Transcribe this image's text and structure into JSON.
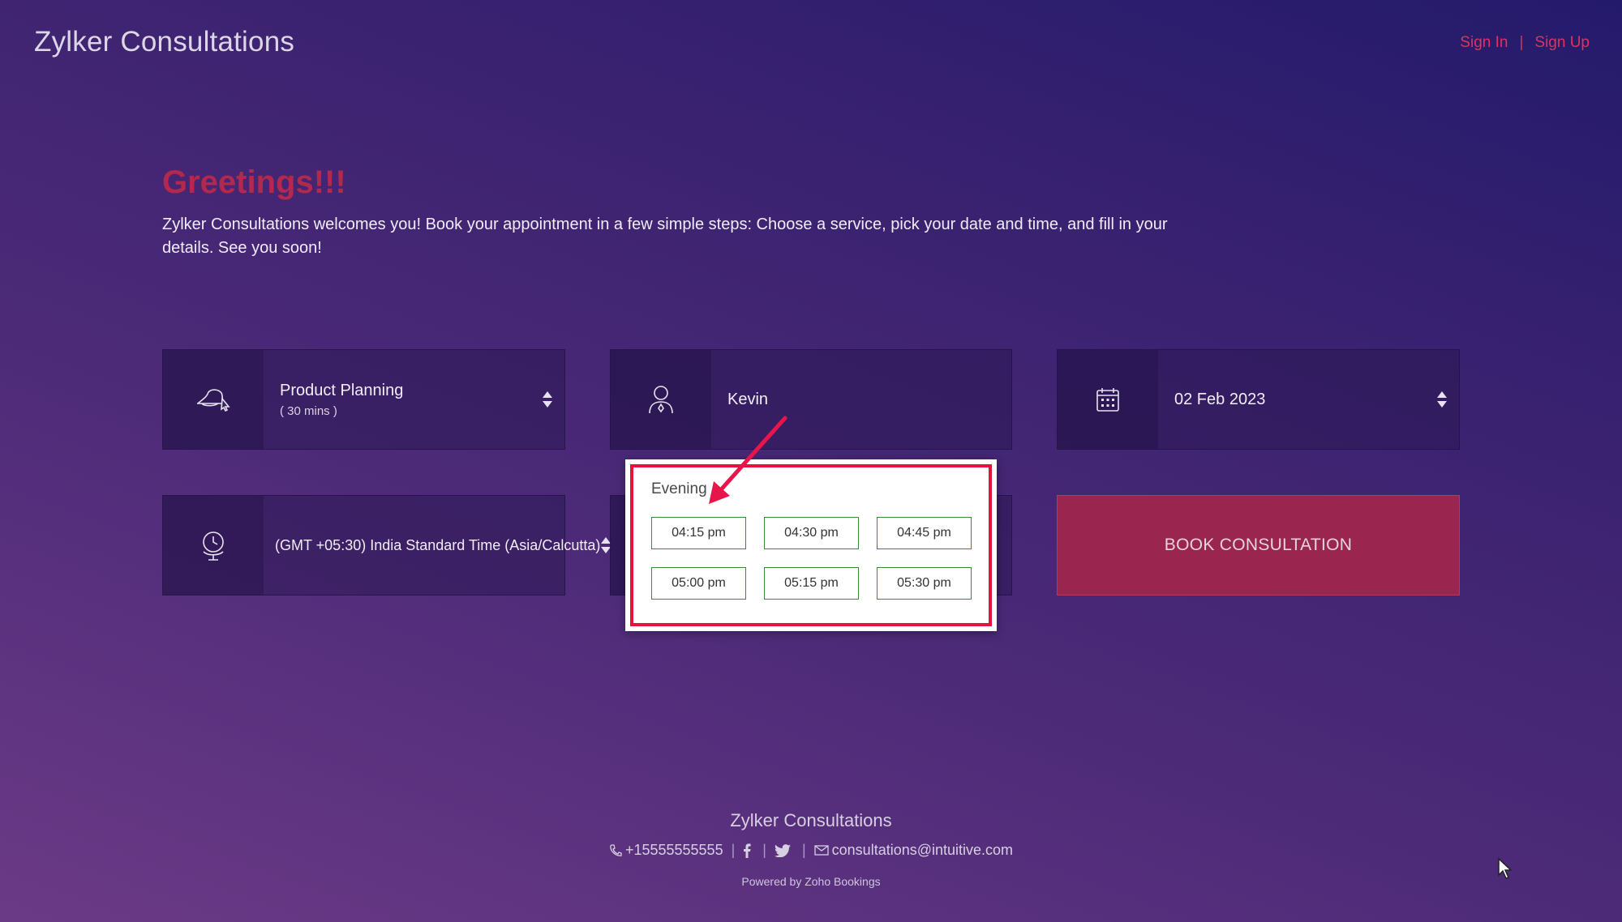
{
  "header": {
    "brand": "Zylker Consultations",
    "sign_in": "Sign In",
    "separator": "|",
    "sign_up": "Sign Up"
  },
  "intro": {
    "greeting": "Greetings!!!",
    "message": "Zylker Consultations welcomes you! Book your appointment in a few simple steps: Choose a service, pick your date and time, and fill in your details. See you soon!"
  },
  "form": {
    "service": {
      "name": "Product Planning",
      "duration": "( 30 mins )",
      "icon": "hat-pointer-icon"
    },
    "staff": {
      "name": "Kevin",
      "icon": "user-icon"
    },
    "date": {
      "value": "02 Feb 2023",
      "icon": "calendar-icon"
    },
    "timezone": {
      "value": "(GMT +05:30) India Standard Time (Asia/Calcutta)",
      "icon": "globe-clock-icon"
    },
    "book_label": "BOOK CONSULTATION"
  },
  "time_popup": {
    "section": "Evening",
    "slots": [
      "04:15 pm",
      "04:30 pm",
      "04:45 pm",
      "05:00 pm",
      "05:15 pm",
      "05:30 pm"
    ]
  },
  "footer": {
    "title": "Zylker Consultations",
    "phone": "+15555555555",
    "email": "consultations@intuitive.com",
    "powered": "Powered by Zoho Bookings"
  },
  "colors": {
    "accent": "#e0325a",
    "book_button": "#9a2650",
    "highlight": "#e2143d",
    "slot_border": "#3a8a3a"
  }
}
